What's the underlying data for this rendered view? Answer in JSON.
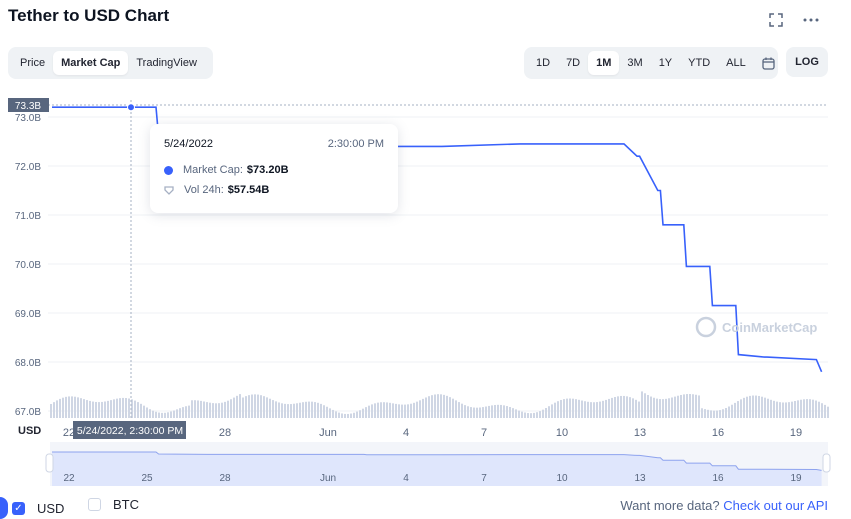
{
  "header": {
    "title": "Tether to USD Chart",
    "fullscreen_icon": "expand-icon",
    "more_icon": "more-dots-icon"
  },
  "view_tabs": [
    {
      "label": "Price",
      "active": false
    },
    {
      "label": "Market Cap",
      "active": true
    },
    {
      "label": "TradingView",
      "active": false
    }
  ],
  "range_tabs": [
    {
      "label": "1D",
      "active": false
    },
    {
      "label": "7D",
      "active": false
    },
    {
      "label": "1M",
      "active": true
    },
    {
      "label": "3M",
      "active": false
    },
    {
      "label": "1Y",
      "active": false
    },
    {
      "label": "YTD",
      "active": false
    },
    {
      "label": "ALL",
      "active": false
    }
  ],
  "calendar_icon": "calendar-icon",
  "log_label": "LOG",
  "tooltip": {
    "date": "5/24/2022",
    "time": "2:30:00 PM",
    "market_cap_label": "Market Cap:",
    "market_cap_value": "$73.20B",
    "volume_label": "Vol 24h:",
    "volume_value": "$57.54B"
  },
  "crosshair": {
    "y_label": "73.3B",
    "x_label": "5/24/2022, 2:30:00 PM"
  },
  "watermark": "CoinMarketCap",
  "legend": {
    "usd": {
      "label": "USD",
      "checked": true
    },
    "btc": {
      "label": "BTC",
      "checked": false
    }
  },
  "footer": {
    "text": "Want more data?",
    "link": "Check out our API"
  },
  "colors": {
    "line": "#3861fb",
    "volume": "#cfd6e4",
    "navigator_fill": "#dfe6fc",
    "grid": "#eff2f5"
  },
  "chart_data": {
    "type": "line",
    "title": "Tether to USD Chart",
    "currency_label": "USD",
    "ylim": [
      67.0,
      73.3
    ],
    "y_ticks": [
      "73.0B",
      "72.0B",
      "71.0B",
      "70.0B",
      "69.0B",
      "68.0B",
      "67.0B"
    ],
    "x_ticks": [
      "22",
      "25",
      "28",
      "Jun",
      "4",
      "7",
      "10",
      "13",
      "16",
      "19"
    ],
    "nav_ticks": [
      "22",
      "25",
      "28",
      "Jun",
      "4",
      "7",
      "10",
      "13",
      "16",
      "19"
    ],
    "series": [
      {
        "name": "Market Cap",
        "unit": "B USD",
        "x_day": [
          0,
          4.0,
          4.1,
          6.0,
          10,
          12.0,
          12.1,
          15.0,
          18.0,
          22.0,
          22.5,
          22.6,
          23.3,
          23.4,
          23.5,
          24.3,
          24.4,
          25.3,
          25.4,
          26.3,
          26.4,
          27.4,
          27.5,
          29.4,
          29.6
        ],
        "values": [
          73.2,
          73.2,
          72.6,
          72.5,
          72.5,
          72.5,
          72.4,
          72.4,
          72.45,
          72.45,
          72.2,
          72.2,
          71.5,
          71.5,
          70.8,
          70.8,
          69.95,
          69.95,
          69.15,
          69.15,
          68.15,
          68.1,
          68.1,
          68.05,
          67.8
        ]
      }
    ]
  }
}
